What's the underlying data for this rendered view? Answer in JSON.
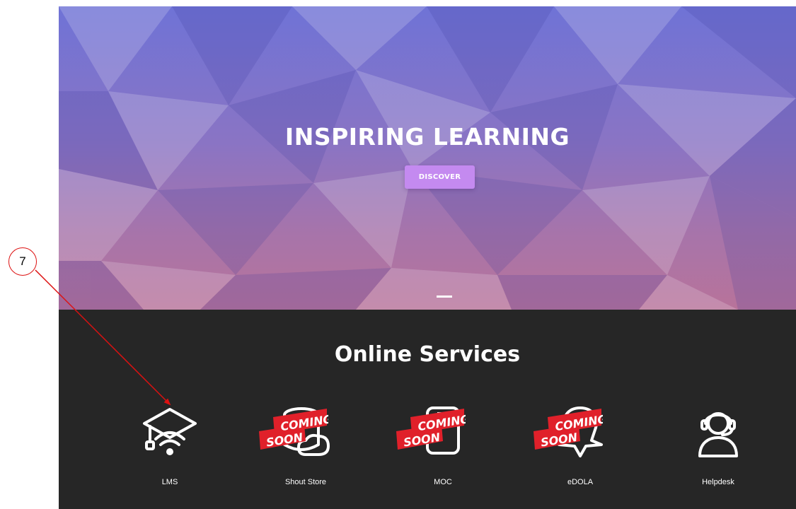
{
  "hero": {
    "title": "INSPIRING LEARNING",
    "button_label": "DISCOVER"
  },
  "services": {
    "title": "Online Services",
    "items": [
      {
        "label": "LMS",
        "icon": "graduation-cap-wifi-icon",
        "coming_soon": false
      },
      {
        "label": "Shout Store",
        "icon": "store-icon",
        "coming_soon": true
      },
      {
        "label": "MOC",
        "icon": "moc-icon",
        "coming_soon": true
      },
      {
        "label": "eDOLA",
        "icon": "edola-icon",
        "coming_soon": true
      },
      {
        "label": "Helpdesk",
        "icon": "headset-user-icon",
        "coming_soon": false
      }
    ],
    "badge_line1": "COMING",
    "badge_line2": "SOON"
  },
  "annotation": {
    "number": "7"
  },
  "colors": {
    "hero_top": "#6f73d6",
    "hero_bottom": "#b8739a",
    "button": "#c48af0",
    "services_bg": "#262626",
    "badge_red": "#e0202a",
    "annotation_red": "#dd1111"
  }
}
